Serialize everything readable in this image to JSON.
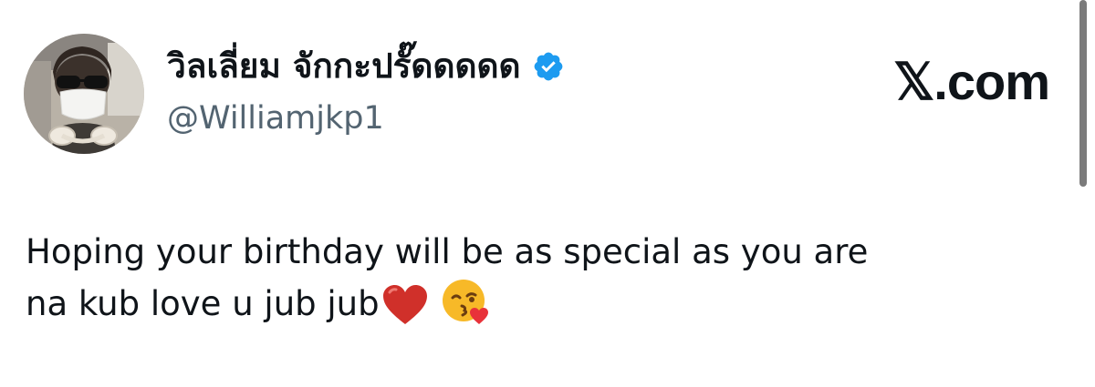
{
  "author": {
    "display_name": "วิลเลี่ยม จักกะปรั๊ดดดดด",
    "handle": "@Williamjkp1",
    "verified": true,
    "verified_badge_color": "#1d9bf0",
    "avatar_icon": "profile-photo"
  },
  "brand": {
    "label": "𝕏.com"
  },
  "tweet": {
    "line1": "Hoping your birthday will be as special as you are",
    "line2": "na kub love u jub jub",
    "emojis": [
      "red-heart-emoji",
      "face-blowing-kiss-emoji"
    ]
  },
  "colors": {
    "text_primary": "#0f1419",
    "text_secondary": "#536471",
    "heart": "#d0302a",
    "emoji_face": "#f7b928"
  }
}
